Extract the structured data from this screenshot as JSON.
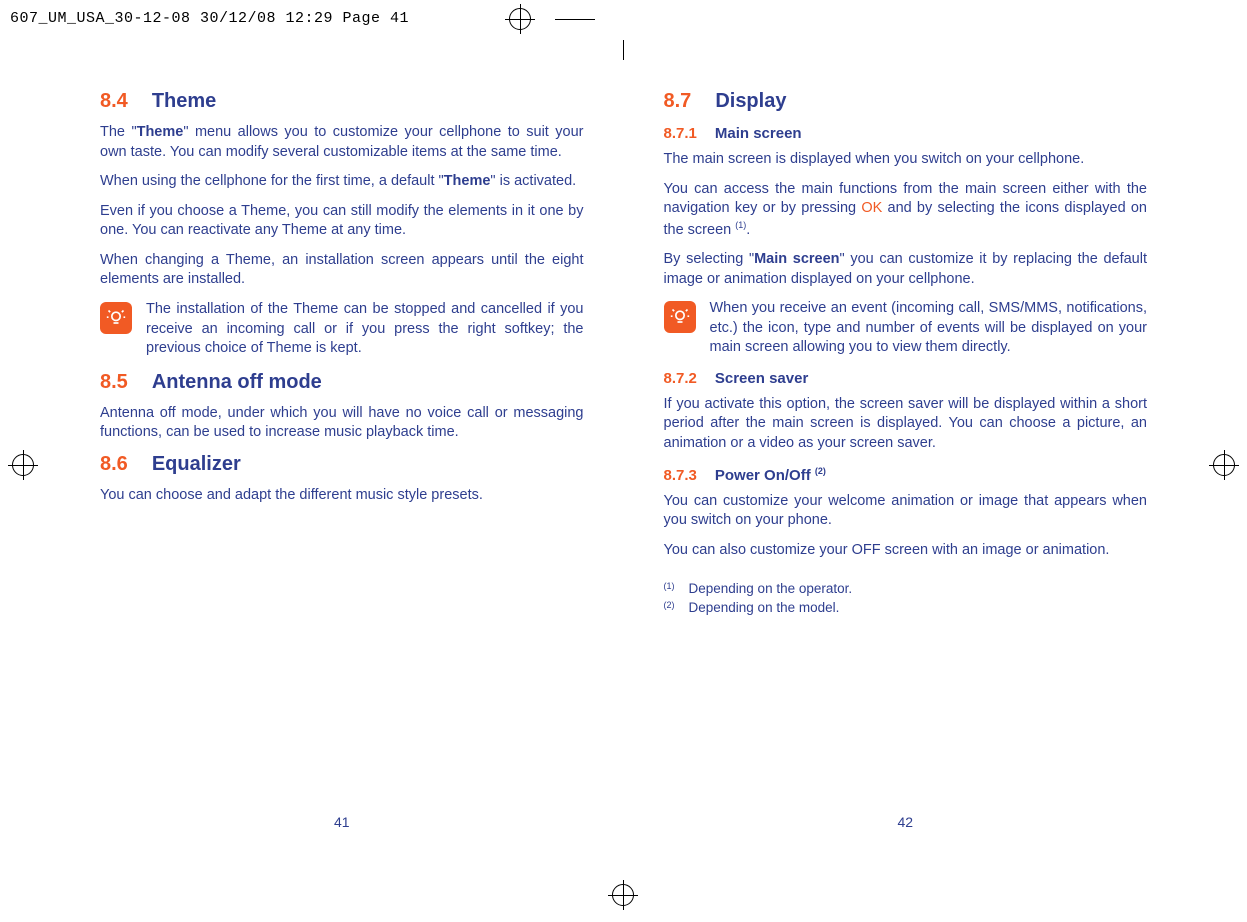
{
  "slug": "607_UM_USA_30-12-08  30/12/08  12:29  Page 41",
  "left": {
    "s84": {
      "num": "8.4",
      "title": "Theme"
    },
    "p84a_pre": "The \"",
    "p84a_bold": "Theme",
    "p84a_post": "\" menu allows you to customize your cellphone to suit your own taste. You can modify several customizable items at the same time.",
    "p84b_pre": "When using the cellphone for the first time, a default \"",
    "p84b_bold": "Theme",
    "p84b_post": "\" is activated.",
    "p84c": "Even if you choose a Theme, you can still modify the elements in it one by one. You can reactivate any Theme at any time.",
    "p84d": "When changing a Theme, an installation screen appears until the eight elements are installed.",
    "note84": "The installation of the Theme can be stopped and cancelled if you receive an incoming call or if you press the right softkey; the previous choice of Theme is kept.",
    "s85": {
      "num": "8.5",
      "title": "Antenna off mode"
    },
    "p85": "Antenna off mode, under which you will have no voice call or messaging functions, can be used to increase music playback time.",
    "s86": {
      "num": "8.6",
      "title": "Equalizer"
    },
    "p86": "You can choose and adapt the different music style presets.",
    "pagenum": "41"
  },
  "right": {
    "s87": {
      "num": "8.7",
      "title": "Display"
    },
    "s871": {
      "num": "8.7.1",
      "title": "Main screen"
    },
    "p871a": "The main screen is displayed when you switch on your cellphone.",
    "p871b_pre": "You can access the main functions from the main screen either with the navigation key or by pressing ",
    "p871b_ok": "OK",
    "p871b_post": " and by selecting the icons displayed on the screen ",
    "p871b_sup": "(1)",
    "p871b_end": ".",
    "p871c_pre": "By selecting \"",
    "p871c_bold": "Main screen",
    "p871c_post": "\" you can customize it by replacing the default image or animation displayed on your cellphone.",
    "note871": "When you receive an event (incoming call, SMS/MMS, notifications, etc.) the icon, type and number of events will be displayed on your main screen allowing you to view them directly.",
    "s872": {
      "num": "8.7.2",
      "title": "Screen saver"
    },
    "p872": "If you activate this option, the screen saver will be displayed within a short period after the main screen is displayed. You can choose a picture, an animation or a video as your screen saver.",
    "s873": {
      "num": "8.7.3",
      "title": "Power On/Off ",
      "sup": "(2)"
    },
    "p873a": "You can customize your welcome animation or image that appears when you switch on your phone.",
    "p873b": "You can also customize your OFF screen with an image or animation.",
    "fn1_mark": "(1)",
    "fn1_text": "Depending on the operator.",
    "fn2_mark": "(2)",
    "fn2_text": "Depending on the model.",
    "pagenum": "42"
  }
}
